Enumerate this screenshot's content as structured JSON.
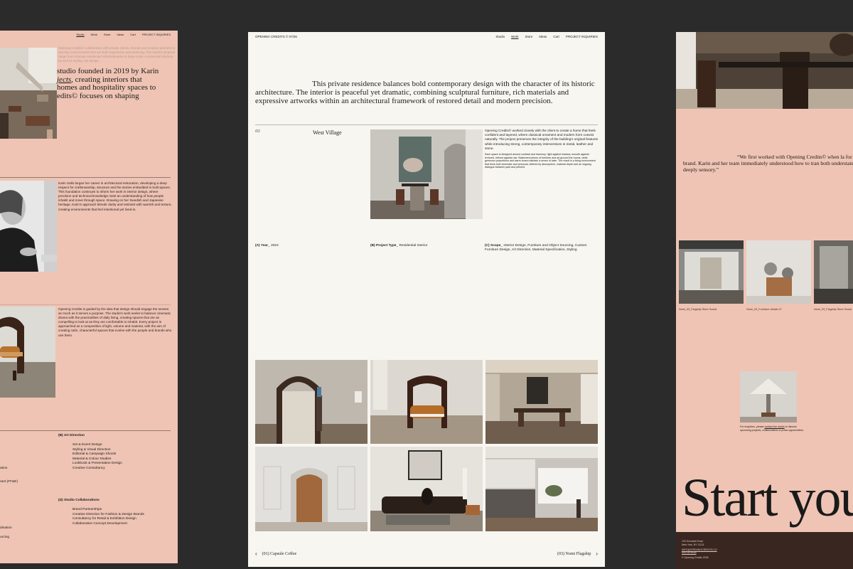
{
  "left": {
    "nav": [
      "Studio",
      "Work",
      "Store",
      "Ideas",
      "Cart",
      "PROJECT INQUIRIES"
    ],
    "faint_text": "Opening Credits© collaborates with private clients, brands and creative partners to develop environments that are both expressive and enduring. The studio's projects range from intimate residential refurbishments to large-scale commercial interiors, as well as styling, set design,",
    "big_text_1": "studio founded in 2019 by Karin",
    "big_text_italic": "jects",
    "big_text_2": ", creating interiors that",
    "big_text_3": "homes and hospitality spaces to",
    "big_text_4": "edits© focuses on shaping",
    "bio": "Karin Sallo began her career in architectural restoration, developing a deep respect for craftsmanship, structure and the stories embedded in built spaces. This foundation continues to inform her work in interior design, where precision and technical knowledge meet an understanding of how people inhabit and move through space. Drawing on her Swedish and Japanese heritage, Karin's approach blends clarity and restraint with warmth and texture, creating environments that feel intentional yet lived-in.",
    "philosophy": "Opening Credits is guided by the idea that design should engage the senses as much as it serves a purpose. The studio's work seeks to balance cinematic drama with the practicalities of daily living, creating spaces that are as compelling to look at as they are comfortable to inhabit. Every project is approached as a composition of light, volume and material, with the aim of creating calm, characterful spaces that evolve with the people and brands who use them.",
    "services": [
      {
        "heading": "(B) Art Direction",
        "items": [
          "Set & Event Design",
          "Styling & Visual Direction",
          "Editorial & Campaign Shoots",
          "Material & Colour Studies",
          "Lookbook & Presentation Design",
          "Creative Consultancy"
        ]
      },
      {
        "heading": "(D) Studio Collaborations",
        "items": [
          "Brand Partnerships",
          "Creative Direction for Fashion & Design Brands",
          "Consultancy for Retail & Exhibition Design",
          "Collaborative Concept Development"
        ]
      }
    ],
    "cut_text": [
      "ation",
      "rant (FF&E)",
      "dination",
      "urcing"
    ]
  },
  "center": {
    "header_left": "OPENING CREDITS © 07/26",
    "nav": [
      "Studio",
      "Work",
      "Store",
      "Ideas",
      "Cart",
      "PROJECT INQUIRIES"
    ],
    "intro": "This private residence balances bold contemporary design with the character of its historic architecture. The interior is peaceful yet dramatic, combining sculptural furniture, rich materials and expressive artworks within an architectural framework of restored detail and modern precision.",
    "project_number": "/02",
    "project_name": "West Village",
    "description_1": "Opening Credits© worked closely with the client to create a home that feels confident and layered, where classical ornament and modern form coexist naturally. The project preserves the integrity of the building's original features while introducing strong, contemporary interventions in metal, leather and stone.",
    "description_2": "Each space is designed around contrast and harmony: light against shadow, smooth against textured, refined against raw. Statement pieces of furniture and art ground the rooms, while generous proportions and warm tones maintain a sense of calm. The result is a living environment that feels both cinematic and personal, defined by atmosphere, material depth and an ongoing dialogue between past and present.",
    "meta": [
      {
        "label": "(A) Year",
        "value": "2024"
      },
      {
        "label": "(B) Project Type",
        "value": "Residential Interior"
      },
      {
        "label": "(C) Scope",
        "value": "Interior Design, Furniture and Object Sourcing, Custom Furniture Design, Art Direction, Material Specification, Styling"
      }
    ],
    "prev": "(01) Capsule Coffee",
    "next": "(03) Nomi Flagship"
  },
  "right": {
    "quote": "“We first worked with Opening Credits© when la for our brand. Karin and her team immediately understood how to tran both understated and deeply sensory.”",
    "captions": [
      "Nomi_03_Flagship Store Social",
      "Nomi_03_Furniture details 07",
      "Nomi_03_Flagship Store Social"
    ],
    "enquiry_prefix": "For enquiries, please ",
    "enquiry_link": "contact the studio",
    "enquiry_suffix": " to discuss upcoming projects, collaborations or press opportunities.",
    "big_text": "Start you",
    "footer_lines": [
      "134 Grenada Road",
      "New York, NY 11211",
      "",
      "INFO@OPENINGCREDITS.CO",
      "INSTAGRAM",
      "",
      "© Opening Credits 2025"
    ]
  }
}
